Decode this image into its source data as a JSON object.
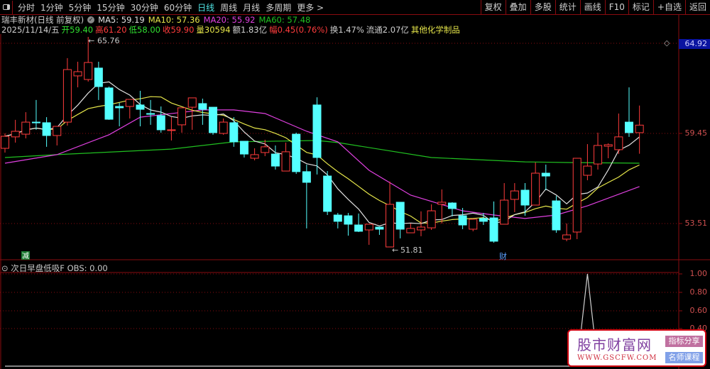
{
  "toolbar": {
    "periods": [
      "分时",
      "1分钟",
      "5分钟",
      "15分钟",
      "30分钟",
      "60分钟",
      "日线",
      "周线",
      "月线",
      "多周期",
      "更多 >"
    ],
    "active_period": "日线",
    "right_buttons": [
      "复权",
      "叠加",
      "多股",
      "统计",
      "画线",
      "F10",
      "标记",
      "+自选",
      "返回"
    ]
  },
  "stock": {
    "title": "瑞丰新材(日线 前复权)",
    "ma5": "MA5: 59.19",
    "ma10": "MA10: 57.36",
    "ma20": "MA20: 55.92",
    "ma60": "MA60: 57.48"
  },
  "quote": {
    "date": "2025/11/14/五",
    "open": "开59.40",
    "high": "高61.20",
    "low": "低58.00",
    "close": "收59.90",
    "volume": "量30594",
    "amount": "额1.83亿",
    "change": "幅0.45(0.76%)",
    "turnover": "换1.47%",
    "float": "流通2.07亿",
    "industry": "其他化学制品"
  },
  "colors": {
    "up": "#ff3c3c",
    "down": "#54ffff",
    "ma5": "#e0e0e0",
    "ma10": "#e6e64a",
    "ma20": "#e040e0",
    "ma60": "#20c020",
    "grid": "#8a0b10"
  },
  "price_axis": {
    "labels": [
      "64.92",
      "59.45",
      "53.51"
    ],
    "label_values": [
      64.92,
      59.45,
      53.51
    ],
    "current_highlight": "64.92"
  },
  "annotations": {
    "high": "65.76",
    "low": "51.81",
    "marker_reduce": "减",
    "marker_finance": "财"
  },
  "chart_data": {
    "type": "candlestick",
    "ohlc": [
      [
        58.36,
        59.16,
        59.35,
        58.08
      ],
      [
        59.12,
        59.49,
        60.25,
        58.74
      ],
      [
        59.3,
        60.1,
        60.76,
        59.02
      ],
      [
        60.1,
        60.06,
        61.57,
        59.59
      ],
      [
        60.06,
        59.21,
        60.43,
        58.46
      ],
      [
        59.21,
        59.82,
        59.82,
        58.55
      ],
      [
        60.1,
        63.59,
        64.35,
        59.87
      ],
      [
        63.17,
        63.45,
        64.11,
        62.41
      ],
      [
        62.93,
        64.06,
        65.76,
        62.79
      ],
      [
        63.69,
        62.46,
        64.11,
        61.57
      ],
      [
        62.37,
        60.29,
        62.46,
        60.25
      ],
      [
        61.14,
        61.05,
        61.38,
        59.82
      ],
      [
        61.14,
        61.61,
        61.61,
        60.34
      ],
      [
        61.24,
        60.95,
        62.18,
        59.82
      ],
      [
        60.67,
        60.62,
        61.57,
        59.92
      ],
      [
        60.53,
        59.59,
        61.14,
        59.4
      ],
      [
        59.54,
        59.59,
        60.43,
        58.88
      ],
      [
        59.92,
        61.05,
        61.05,
        59.4
      ],
      [
        61.09,
        61.71,
        61.71,
        59.59
      ],
      [
        61.33,
        60.95,
        61.66,
        59.92
      ],
      [
        61.09,
        59.4,
        61.09,
        59.26
      ],
      [
        59.35,
        60.1,
        60.34,
        59.26
      ],
      [
        60.06,
        58.79,
        60.43,
        58.46
      ],
      [
        58.83,
        57.98,
        58.83,
        57.75
      ],
      [
        57.7,
        57.94,
        58.36,
        57.56
      ],
      [
        58.08,
        58.46,
        58.93,
        57.84
      ],
      [
        57.98,
        57.18,
        58.55,
        56.95
      ],
      [
        56.85,
        58.13,
        58.74,
        56.85
      ],
      [
        59.3,
        56.81,
        59.4,
        56.66
      ],
      [
        56.81,
        56.1,
        57.28,
        53.04
      ],
      [
        61.24,
        57.75,
        61.75,
        56.62
      ],
      [
        56.52,
        54.17,
        56.85,
        53.93
      ],
      [
        53.93,
        53.51,
        54.07,
        53.04
      ],
      [
        53.88,
        53.32,
        54.07,
        52.56
      ],
      [
        53.27,
        52.85,
        54.03,
        52.8
      ],
      [
        52.94,
        53.32,
        53.32,
        51.95
      ],
      [
        53.13,
        52.99,
        53.13,
        52.61
      ],
      [
        51.81,
        54.64,
        56.15,
        51.81
      ],
      [
        54.78,
        52.99,
        54.78,
        52.38
      ],
      [
        52.75,
        53.04,
        53.37,
        52.75
      ],
      [
        52.94,
        53.13,
        54.17,
        52.52
      ],
      [
        53.08,
        54.21,
        54.64,
        52.94
      ],
      [
        54.64,
        54.78,
        55.63,
        53.37
      ],
      [
        54.73,
        54.36,
        54.78,
        53.84
      ],
      [
        53.88,
        53.27,
        54.4,
        52.99
      ],
      [
        52.99,
        53.65,
        53.65,
        52.85
      ],
      [
        53.7,
        53.51,
        54.07,
        53.27
      ],
      [
        53.74,
        52.19,
        54.83,
        52.09
      ],
      [
        53.32,
        54.92,
        56.05,
        53.32
      ],
      [
        54.97,
        55.53,
        56.05,
        54.12
      ],
      [
        55.58,
        54.59,
        56.05,
        53.88
      ],
      [
        54.59,
        56.71,
        57.42,
        54.59
      ],
      [
        56.71,
        56.52,
        57.28,
        55.58
      ],
      [
        54.87,
        52.94,
        55.2,
        52.75
      ],
      [
        52.33,
        52.61,
        53.37,
        52.19
      ],
      [
        52.8,
        57.7,
        57.7,
        52.33
      ],
      [
        56.57,
        57.18,
        58.64,
        56.24
      ],
      [
        57.32,
        58.55,
        59.4,
        56.95
      ],
      [
        58.5,
        58.6,
        58.69,
        57.7
      ],
      [
        58.27,
        59.12,
        60.67,
        57.98
      ],
      [
        60.1,
        59.4,
        62.41,
        59.12
      ],
      [
        59.4,
        59.9,
        61.2,
        58.0
      ]
    ],
    "ma20_samples": [
      [
        0,
        57.37
      ],
      [
        5,
        57.94
      ],
      [
        10,
        59.26
      ],
      [
        13,
        60.43
      ],
      [
        19,
        60.91
      ],
      [
        22,
        60.91
      ],
      [
        25,
        60.67
      ],
      [
        29,
        59.49
      ],
      [
        32,
        58.79
      ],
      [
        35,
        56.9
      ],
      [
        39,
        55.25
      ],
      [
        44,
        54.21
      ],
      [
        47,
        53.93
      ],
      [
        50,
        53.7
      ],
      [
        53,
        53.93
      ],
      [
        56,
        54.54
      ],
      [
        61,
        55.82
      ]
    ],
    "ma60_samples": [
      [
        0,
        57.75
      ],
      [
        5,
        57.94
      ],
      [
        16,
        58.31
      ],
      [
        22,
        58.79
      ],
      [
        30,
        58.88
      ],
      [
        32,
        58.74
      ],
      [
        41,
        57.75
      ],
      [
        50,
        57.46
      ],
      [
        54,
        57.42
      ],
      [
        61,
        57.37
      ]
    ],
    "ylim": [
      51.81,
      65.76
    ]
  },
  "indicator": {
    "title": "次日早盘低吸F",
    "value_label": "OBS: 0.00",
    "axis_labels": [
      "1.00",
      "0.80",
      "0.60",
      "0.40"
    ],
    "axis_values": [
      1.0,
      0.8,
      0.6,
      0.4
    ],
    "series": [
      0,
      0,
      0,
      0,
      0,
      0,
      0,
      0,
      0,
      0,
      0,
      0,
      0,
      0,
      0,
      0,
      0,
      0,
      0,
      0,
      0,
      0,
      0,
      0,
      0,
      0,
      0,
      0,
      0,
      0,
      0,
      0,
      0,
      0,
      0,
      0,
      0,
      0,
      0,
      0,
      0,
      0,
      0,
      0,
      0,
      0,
      0,
      0,
      0,
      0,
      0,
      0,
      0,
      0,
      0,
      0,
      1,
      0,
      0,
      0,
      0,
      0
    ]
  },
  "watermark": {
    "title": "股市财富网",
    "url": "WWW.GSCFW.COM",
    "tag1": "指标分享",
    "tag2": "名师课程"
  }
}
